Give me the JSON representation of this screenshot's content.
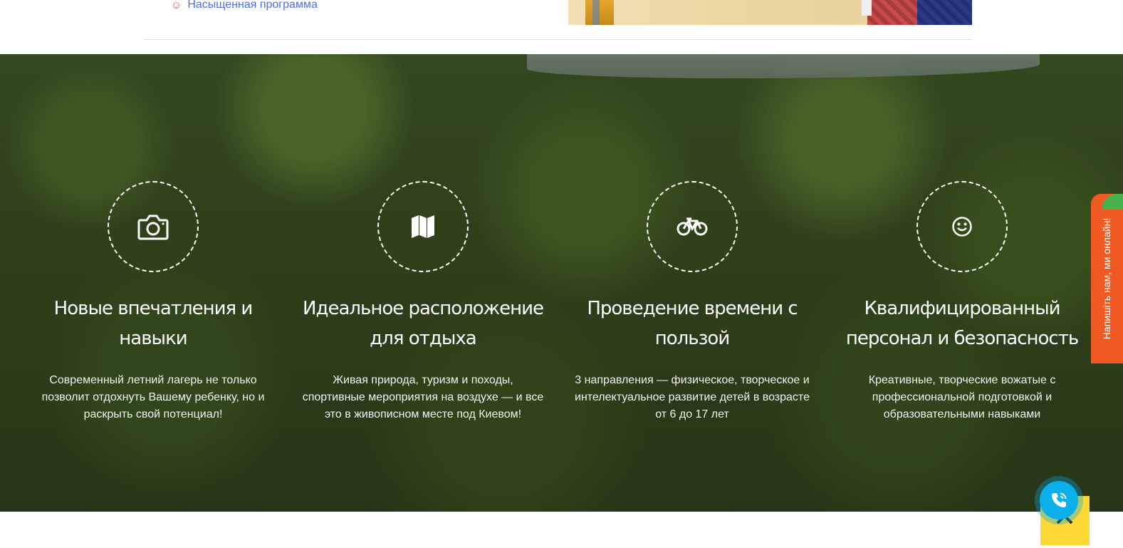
{
  "top": {
    "program_item": "Насыщенная программа",
    "program_icon": "smile-icon"
  },
  "features": [
    {
      "icon": "camera-icon",
      "title": "Новые впечатления и навыки",
      "text": "Современный летний лагерь не только позволит отдохнуть Вашему ребенку, но и раскрыть свой потенциал!"
    },
    {
      "icon": "map-icon",
      "title": "Идеальное расположение для отдыха",
      "text": "Живая природа, туризм и походы, спортивные мероприятия на воздухе — и все это в живописном месте под Киевом!"
    },
    {
      "icon": "bicycle-icon",
      "title": "Проведение времени с пользой",
      "text": "3 направления — физическое, творческое и интелектуальное развитие детей в возрасте от 6 до 17 лет"
    },
    {
      "icon": "smile-icon",
      "title": "Квалифицированный персонал и безопасность",
      "text": "Креативные, творческие вожатые с профессиональной подготовкой и образовательными навыками"
    }
  ],
  "chat_tab": {
    "label": "Напишіть нам, ми онлайн!"
  },
  "widgets": {
    "call_icon": "phone-icon",
    "scroll_icon": "chevron-up-icon"
  },
  "colors": {
    "link": "#4f6ee8",
    "chat_tab": "#f05a22",
    "scroll_top": "#fdd835",
    "call_button": "#0bb0ea"
  }
}
